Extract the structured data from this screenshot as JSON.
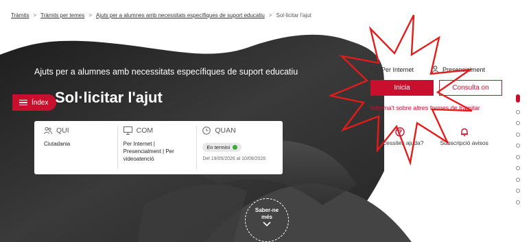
{
  "breadcrumb": {
    "items": [
      "Tràmits",
      "Tràmits per temes",
      "Ajuts per a alumnes amb necessitats específiques de suport educatiu"
    ],
    "current": "Sol·licitar l'ajut",
    "separator": ">"
  },
  "hero": {
    "subtitle": "Ajuts per a alumnes amb necessitats específiques de suport educatiu",
    "title": "Sol·licitar l'ajut"
  },
  "index_button": {
    "label": "Índex",
    "icon": "menu-icon"
  },
  "info_card": {
    "qui": {
      "heading": "QUI",
      "icon": "people-icon",
      "text": "Ciutadania"
    },
    "com": {
      "heading": "COM",
      "icon": "monitor-icon",
      "text": "Per Internet | Presencialment | Per videoatenció"
    },
    "quan": {
      "heading": "QUAN",
      "icon": "clock-icon",
      "status": "En termini",
      "status_color": "#3aaa35",
      "dates": "Del 19/05/2026 al 10/09/2026"
    }
  },
  "saber": {
    "label_line1": "Saber-ne",
    "label_line2": "més",
    "icon": "chevron-down-icon"
  },
  "right_panel": {
    "tabs": [
      {
        "label": "Per Internet",
        "icon": "browser-icon"
      },
      {
        "label": "Presencialment",
        "icon": "person-icon"
      }
    ],
    "primary_button": "Inicia",
    "secondary_button": "Consulta on",
    "other_link": "Informa't sobre altres formes de tramitar",
    "help": [
      {
        "label": "Necessites ajuda?",
        "icon": "help-icon"
      },
      {
        "label": "Subscripció avisos",
        "icon": "bell-icon"
      }
    ]
  },
  "colors": {
    "accent": "#c8102e",
    "hero_dark": "#2b2b2b",
    "white": "#ffffff"
  },
  "scroll_dots": {
    "active_index": 0,
    "count": 10
  }
}
